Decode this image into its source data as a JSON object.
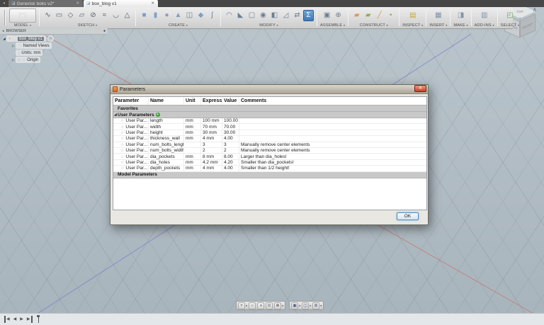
{
  "tabs": [
    {
      "label": "Generisk boks v2*",
      "active": false
    },
    {
      "label": "box_blog v1",
      "active": true
    }
  ],
  "toolbar": {
    "groups": [
      {
        "label": "MODEL",
        "big": true,
        "icons": [
          {
            "name": "model-workspace-cube-icon"
          }
        ]
      },
      {
        "label": "SKETCH",
        "icons": [
          {
            "name": "sketch-spline-icon"
          },
          {
            "name": "sketch-rectangle-icon"
          },
          {
            "name": "sketch-polygon-icon"
          },
          {
            "name": "sketch-slot-icon"
          },
          {
            "name": "sketch-circle-icon"
          },
          {
            "name": "sketch-fit-curve-icon"
          },
          {
            "name": "sketch-arc-icon"
          },
          {
            "name": "sketch-3d-icon"
          }
        ]
      },
      {
        "label": "CREATE",
        "icons": [
          {
            "name": "create-box-icon"
          },
          {
            "name": "create-cylinder-icon"
          },
          {
            "name": "create-form-icon"
          },
          {
            "name": "create-extrude-icon"
          },
          {
            "name": "create-mirror-icon"
          },
          {
            "name": "create-loft-icon"
          },
          {
            "name": "create-coil-icon"
          }
        ]
      },
      {
        "label": "MODIFY",
        "icons": [
          {
            "name": "modify-fillet-icon"
          },
          {
            "name": "modify-chamfer-icon"
          },
          {
            "name": "modify-shell-icon"
          },
          {
            "name": "modify-combine-icon"
          },
          {
            "name": "modify-split-body-icon"
          },
          {
            "name": "modify-draft-icon"
          },
          {
            "name": "modify-move-icon"
          },
          {
            "name": "change-parameters-icon",
            "active": true
          }
        ]
      },
      {
        "label": "ASSEMBLE",
        "icons": [
          {
            "name": "assemble-new-component-icon"
          },
          {
            "name": "assemble-joint-icon"
          }
        ]
      },
      {
        "label": "CONSTRUCT",
        "icons": [
          {
            "name": "construct-offset-plane-icon"
          },
          {
            "name": "construct-midplane-icon"
          },
          {
            "name": "construct-axis-icon"
          },
          {
            "name": "construct-point-icon"
          }
        ]
      },
      {
        "label": "INSPECT",
        "icons": [
          {
            "name": "inspect-measure-icon"
          }
        ]
      },
      {
        "label": "INSERT",
        "icons": [
          {
            "name": "insert-image-icon"
          }
        ]
      },
      {
        "label": "MAKE",
        "icons": [
          {
            "name": "make-icon"
          }
        ]
      },
      {
        "label": "ADD-INS",
        "icons": [
          {
            "name": "add-ins-icon"
          }
        ]
      },
      {
        "label": "SELECT",
        "icons": [
          {
            "name": "select-cursor-icon"
          }
        ]
      }
    ],
    "caret": "▾"
  },
  "browser": {
    "header": "BROWSER",
    "rows": [
      {
        "level": 0,
        "expander": "expanded",
        "icons": [
          "lightbulb-on-icon",
          "component-cube-icon"
        ],
        "label": "box_blog v1",
        "selected": true,
        "badge": "document-settings-icon"
      },
      {
        "level": 1,
        "expander": "collapsed",
        "icons": [
          "folder-icon"
        ],
        "label": "Named Views",
        "selected": false,
        "badge": null
      },
      {
        "level": 1,
        "expander": null,
        "icons": [
          "document-icon"
        ],
        "label": "Units: mm",
        "selected": false,
        "badge": null
      },
      {
        "level": 1,
        "expander": "collapsed",
        "icons": [
          "lightbulb-off-icon",
          "folder-icon"
        ],
        "label": "Origin",
        "selected": false,
        "badge": null
      }
    ]
  },
  "dialog": {
    "title": "Parameters",
    "ok_label": "OK",
    "table": {
      "columns": [
        "Parameter",
        "Name",
        "Unit",
        "Expression",
        "Value",
        "Comments"
      ],
      "groups": [
        {
          "label": "Favorites",
          "expander": null,
          "plus": false,
          "rows": []
        },
        {
          "label": "User Parameters",
          "expander": "expanded",
          "plus": true,
          "rows": [
            {
              "param": "User Par...",
              "name": "length",
              "unit": "mm",
              "expression": "100 mm",
              "value": "100.00",
              "comments": ""
            },
            {
              "param": "User Par...",
              "name": "width",
              "unit": "mm",
              "expression": "70 mm",
              "value": "70.00",
              "comments": ""
            },
            {
              "param": "User Par...",
              "name": "height",
              "unit": "mm",
              "expression": "30 mm",
              "value": "30.00",
              "comments": ""
            },
            {
              "param": "User Par...",
              "name": "thickness_wall",
              "unit": "mm",
              "expression": "4 mm",
              "value": "4.00",
              "comments": ""
            },
            {
              "param": "User Par...",
              "name": "num_bolts_length",
              "unit": "",
              "expression": "3",
              "value": "3",
              "comments": "Manually remove center elements"
            },
            {
              "param": "User Par...",
              "name": "num_bolts_width",
              "unit": "",
              "expression": "2",
              "value": "2",
              "comments": "Manually remove center elements"
            },
            {
              "param": "User Par...",
              "name": "dia_pockets",
              "unit": "mm",
              "expression": "8 mm",
              "value": "8.00",
              "comments": "Larger than dia_holes!"
            },
            {
              "param": "User Par...",
              "name": "dia_holes",
              "unit": "mm",
              "expression": "4.2 mm",
              "value": "4.20",
              "comments": "Smaller than dia_pockets!"
            },
            {
              "param": "User Par...",
              "name": "depth_pockets",
              "unit": "mm",
              "expression": "4 mm",
              "value": "4.00",
              "comments": "Smaller than 1/2 height!"
            }
          ]
        },
        {
          "label": "Model Parameters",
          "expander": null,
          "plus": false,
          "rows": []
        }
      ]
    }
  },
  "navbar": {
    "cluster1": [
      {
        "name": "pan-icon",
        "caret": true
      },
      {
        "name": "orbit-icon",
        "caret": false
      },
      {
        "name": "free-orbit-icon",
        "caret": false
      },
      {
        "name": "look-at-icon",
        "caret": false
      },
      {
        "name": "zoom-icon",
        "caret": true
      }
    ],
    "cluster2": [
      {
        "name": "display-settings-icon",
        "caret": true
      },
      {
        "name": "viewports-icon",
        "caret": true
      },
      {
        "name": "layout-grid-icon",
        "caret": true
      }
    ]
  },
  "timeline": {
    "buttons": [
      {
        "name": "go-to-start-button"
      },
      {
        "name": "step-back-button"
      },
      {
        "name": "play-button"
      },
      {
        "name": "go-to-end-button"
      }
    ]
  },
  "viewport": {
    "viewcube": {
      "top": "TOP",
      "front": "FRONT",
      "right": "RIGHT"
    },
    "axis_colors": {
      "x_axis": "#c4756b",
      "y_axis": "#7781c9"
    }
  }
}
